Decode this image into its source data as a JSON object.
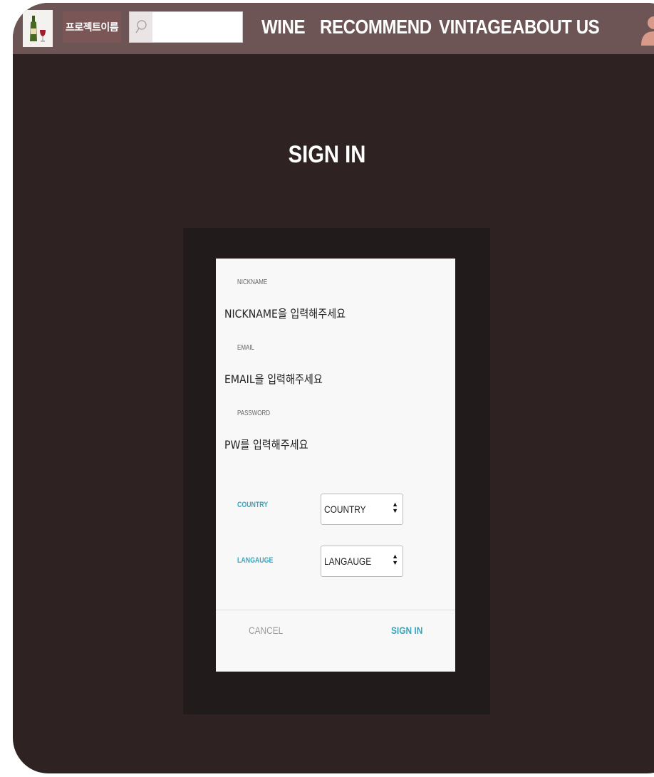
{
  "header": {
    "brand": "프로젝트이름",
    "search": {
      "placeholder": ""
    },
    "nav": [
      "WINE",
      "RECOMMEND",
      "VINTAGE",
      "ABOUT US"
    ]
  },
  "page": {
    "title": "SIGN IN"
  },
  "form": {
    "nickname": {
      "label": "NICKNAME",
      "placeholder": "NICKNAME을 입력해주세요"
    },
    "email": {
      "label": "EMAIL",
      "placeholder": "EMAIL을 입력해주세요"
    },
    "password": {
      "label": "PASSWORD",
      "placeholder": "PW를 입력해주세요"
    },
    "country": {
      "label": "COUNTRY",
      "selected": "COUNTRY"
    },
    "language": {
      "label": "LANGAUGE",
      "selected": "LANGAUGE"
    },
    "cancel_label": "CANCEL",
    "submit_label": "SIGN IN"
  },
  "icons": {
    "logo": "wine-bottle-icon",
    "search": "search-icon",
    "profile": "user-icon"
  },
  "colors": {
    "topbar": "#6e5555",
    "background": "#2e2322",
    "accent": "#3aa5bd"
  }
}
